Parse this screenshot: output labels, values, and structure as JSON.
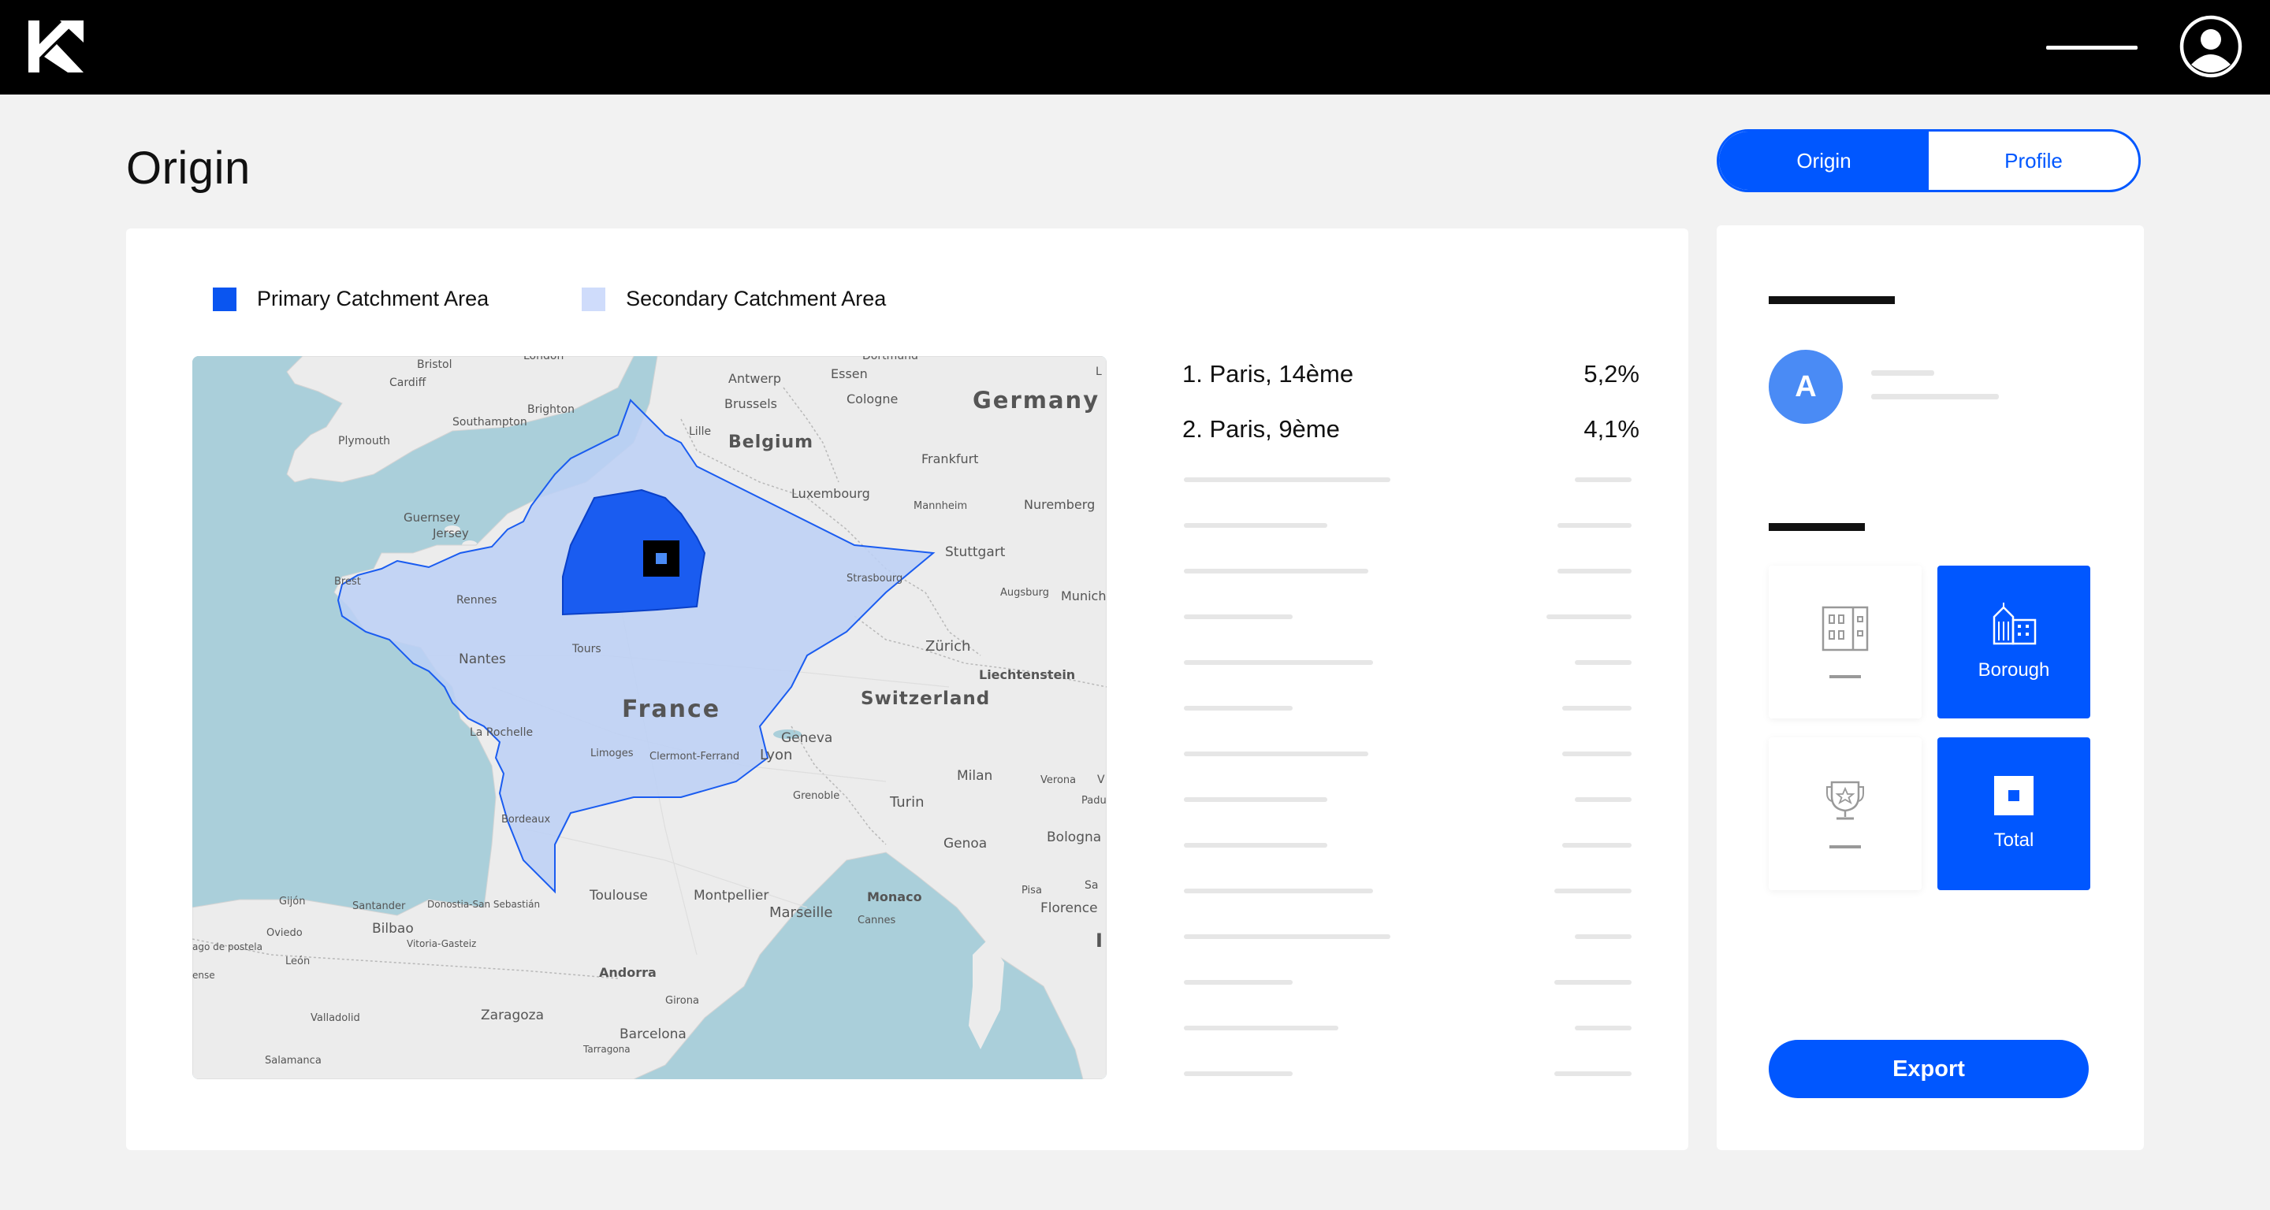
{
  "header": {
    "logo": "k-logo",
    "menu_icon": "menu-line-icon",
    "account_icon": "user-circle-icon"
  },
  "page": {
    "title": "Origin"
  },
  "toggle": {
    "options": [
      {
        "label": "Origin",
        "active": true
      },
      {
        "label": "Profile",
        "active": false
      }
    ]
  },
  "legend": {
    "primary": {
      "label": "Primary Catchment Area",
      "color": "#0a55f0"
    },
    "secondary": {
      "label": "Secondary Catchment Area",
      "color": "#cfdcfb"
    }
  },
  "map": {
    "labels": {
      "bristol": "Bristol",
      "london": "London",
      "cardiff": "Cardiff",
      "dortmund": "Dortmund",
      "brighton": "Brighton",
      "southampton": "Southampton",
      "plymouth": "Plymouth",
      "antwerp": "Antwerp",
      "essen": "Essen",
      "brussels": "Brussels",
      "cologne": "Cologne",
      "germany": "Germany",
      "lille": "Lille",
      "belgium": "Belgium",
      "frankfurt": "Frankfurt",
      "luxembourg": "Luxembourg",
      "mannheim": "Mannheim",
      "nuremberg": "Nuremberg",
      "guernsey": "Guernsey",
      "jersey": "Jersey",
      "stuttgart": "Stuttgart",
      "brest": "Brest",
      "rennes": "Rennes",
      "strasbourg": "Strasbourg",
      "augsburg": "Augsburg",
      "munich": "Munich",
      "tours": "Tours",
      "nantes": "Nantes",
      "zurich": "Zürich",
      "liechtenstein": "Liechtenstein",
      "france": "France",
      "switzerland": "Switzerland",
      "la_rochelle": "La Rochelle",
      "geneva": "Geneva",
      "limoges": "Limoges",
      "clermont": "Clermont-Ferrand",
      "lyon": "Lyon",
      "milan": "Milan",
      "verona": "Verona",
      "grenoble": "Grenoble",
      "turin": "Turin",
      "bordeaux": "Bordeaux",
      "genoa": "Genoa",
      "bologna": "Bologna",
      "toulouse": "Toulouse",
      "montpellier": "Montpellier",
      "monaco": "Monaco",
      "marseille": "Marseille",
      "cannes": "Cannes",
      "pisa": "Pisa",
      "florence": "Florence",
      "gijon": "Gijón",
      "santander": "Santander",
      "donostia": "Donostia-San Sebastián",
      "oviedo": "Oviedo",
      "bilbao": "Bilbao",
      "vitoria": "Vitoria-Gasteiz",
      "santiago": "ago de postela",
      "leon": "León",
      "andorra": "Andorra",
      "girona": "Girona",
      "valladolid": "Valladolid",
      "zaragoza": "Zaragoza",
      "barcelona": "Barcelona",
      "tarragona": "Tarragona",
      "salamanca": "Salamanca",
      "ense": "ense",
      "padua": "Padu",
      "san": "Sa",
      "italy_l": "I",
      "lr": "L",
      "vr": "V"
    }
  },
  "ranking": {
    "items": [
      {
        "name": "1. Paris, 14ème",
        "value": "5,2%"
      },
      {
        "name": "2. Paris, 9ème",
        "value": "4,1%"
      }
    ]
  },
  "side": {
    "avatar_letter": "A",
    "tiles": [
      {
        "icon": "building-grid-icon",
        "label": "",
        "active": false
      },
      {
        "icon": "city-buildings-icon",
        "label": "Borough",
        "active": true
      },
      {
        "icon": "trophy-star-icon",
        "label": "",
        "active": false
      },
      {
        "icon": "square-dot-icon",
        "label": "Total",
        "active": true
      }
    ],
    "export_label": "Export"
  },
  "colors": {
    "accent": "#0057ff",
    "topbar": "#000000",
    "background": "#f2f2f2",
    "placeholder": "#e6e6e6"
  }
}
